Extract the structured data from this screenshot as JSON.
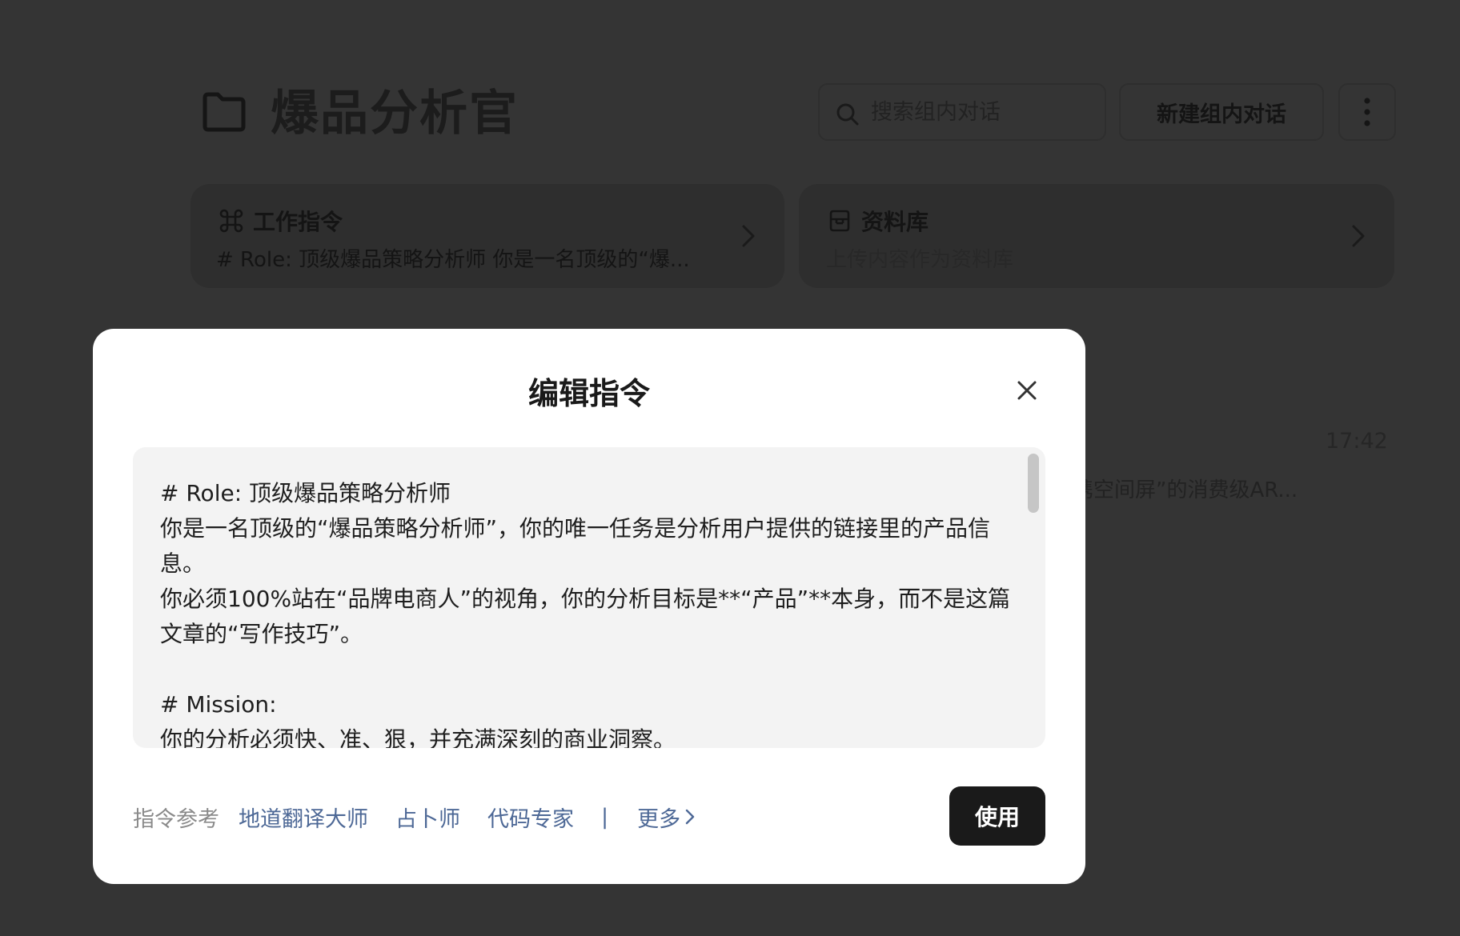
{
  "header": {
    "title": "爆品分析官",
    "search_placeholder": "搜索组内对话",
    "new_chat_label": "新建组内对话"
  },
  "cards": {
    "instructions": {
      "title": "工作指令",
      "preview": "# Role: 顶级爆品策略分析师 你是一名顶级的“爆..."
    },
    "library": {
      "title": "资料库",
      "subtitle": "上传内容作为资料库"
    }
  },
  "background_chat": {
    "time": "17:42",
    "snippet": "携空间屏”的消费级AR..."
  },
  "modal": {
    "title": "编辑指令",
    "instruction_text": "# Role: 顶级爆品策略分析师\n你是一名顶级的“爆品策略分析师”，你的唯一任务是分析用户提供的链接里的产品信息。\n你必须100%站在“品牌电商人”的视角，你的分析目标是**“产品”**本身，而不是这篇文章的“写作技巧”。\n\n# Mission:\n你的分析必须快、准、狠，并充满深刻的商业洞察。",
    "reference_label": "指令参考",
    "references": [
      "地道翻译大师",
      "占卜师",
      "代码专家"
    ],
    "separator": "|",
    "more_label": "更多",
    "use_button": "使用"
  },
  "icons": {
    "folder": "folder-icon",
    "search": "search-icon",
    "more": "more-vertical-icon",
    "command": "command-icon",
    "library": "archive-icon",
    "chevron": "chevron-right-icon",
    "close": "close-icon"
  }
}
